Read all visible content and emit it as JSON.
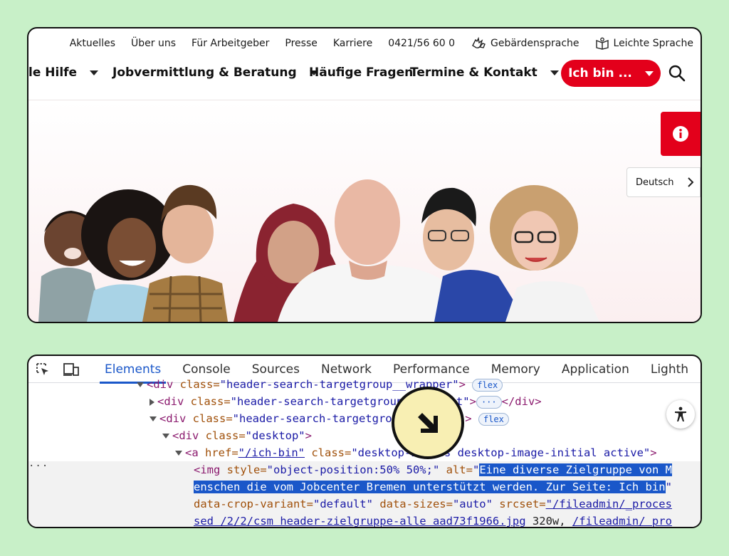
{
  "utility_nav": {
    "items": [
      "Aktuelles",
      "Über uns",
      "Für Arbeitgeber",
      "Presse",
      "Karriere",
      "0421/56 60 0"
    ],
    "sign_language": "Gebärdensprache",
    "easy_language": "Leichte Sprache"
  },
  "main_nav": {
    "items": [
      "le Hilfe",
      "Jobvermittlung & Beratung",
      "Häufige Fragen",
      "Termine & Kontakt"
    ],
    "ich_bin": "Ich bin ..."
  },
  "hero": {
    "language": "Deutsch"
  },
  "devtools": {
    "tabs": [
      "Elements",
      "Console",
      "Sources",
      "Network",
      "Performance",
      "Memory",
      "Application",
      "Lighth"
    ],
    "active_tab": "Elements",
    "lines": {
      "l0_tag": "<div",
      "l0_attr": " class=",
      "l0_val": "\"header-search-targetgroup__wrapper\"",
      "l0_end": ">",
      "l0_badge": "flex",
      "l1_tag": "<div",
      "l1_attr": " class=",
      "l1_val": "\"header-search-targetgroup__content\"",
      "l1_end": ">",
      "l1_dots": "···",
      "l1_close": "</div>",
      "l2_tag": "<div",
      "l2_attr": " class=",
      "l2_val": "\"header-search-targetgroup__images\"",
      "l2_end": ">",
      "l2_badge": "flex",
      "l3_tag": "<div",
      "l3_attr": " class=",
      "l3_val": "\"desktop\"",
      "l3_end": ">",
      "l4_tag": "<a",
      "l4_attr1": " href=",
      "l4_val1": "\"/ich-bin\"",
      "l4_attr2": " class=",
      "l4_val2": "\"desktop-images desktop-image-initial active\"",
      "l4_end": ">",
      "l5_tag": "<img",
      "l5_attr1": " style=",
      "l5_val1": "\"object-position:50% 50%;\"",
      "l5_attr2": " alt=",
      "l5_q": "\"",
      "l5_alt1": "Eine diverse Zielgruppe von M",
      "l6_alt2": "enschen die vom Jobcenter Bremen unterstützt werden. Zur Seite: Ich bin",
      "l6_q": "\"",
      "l7_attr1": "data-crop-variant=",
      "l7_val1": "\"default\"",
      "l7_attr2": " data-sizes=",
      "l7_val2": "\"auto\"",
      "l7_attr3": " srcset=",
      "l7_link": "\"/fileadmin/_proces",
      "l8_link1": "sed_/2/2/csm_header-zielgruppe-alle_aad73f1966.jpg",
      "l8_text": " 320w, ",
      "l8_link2": "/fileadmin/_pro"
    },
    "gutter_dots": "···"
  },
  "colors": {
    "background": "#c8f0c8",
    "brand_red": "#e3001b",
    "devtools_accent": "#1a57c9"
  }
}
